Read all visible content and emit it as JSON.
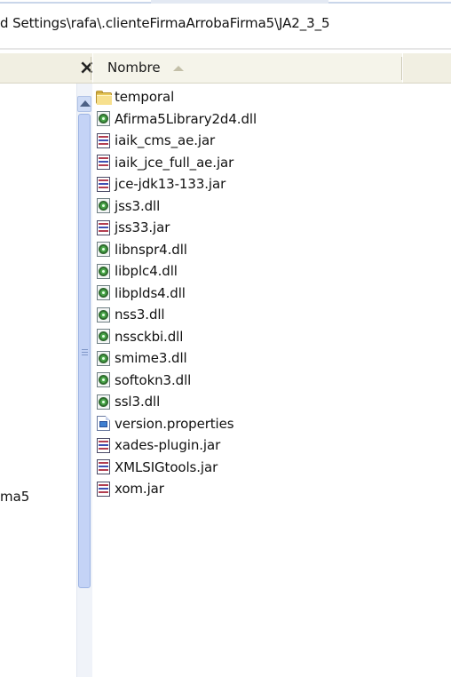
{
  "address_bar": {
    "path_text": "d Settings\\rafa\\.clienteFirmaArrobaFirma5\\JA2_3_5"
  },
  "folder_pane": {
    "close_label": "×",
    "partial_item_label": "ma5"
  },
  "columns": {
    "name_header": "Nombre",
    "sort_icon": "sort-ascending-arrow"
  },
  "files": [
    {
      "name": "temporal",
      "icon": "folder-icon"
    },
    {
      "name": "Afirma5Library2d4.dll",
      "icon": "dll-icon"
    },
    {
      "name": "iaik_cms_ae.jar",
      "icon": "jar-icon"
    },
    {
      "name": "iaik_jce_full_ae.jar",
      "icon": "jar-icon"
    },
    {
      "name": "jce-jdk13-133.jar",
      "icon": "jar-icon"
    },
    {
      "name": "jss3.dll",
      "icon": "dll-icon"
    },
    {
      "name": "jss33.jar",
      "icon": "jar-icon"
    },
    {
      "name": "libnspr4.dll",
      "icon": "dll-icon"
    },
    {
      "name": "libplc4.dll",
      "icon": "dll-icon"
    },
    {
      "name": "libplds4.dll",
      "icon": "dll-icon"
    },
    {
      "name": "nss3.dll",
      "icon": "dll-icon"
    },
    {
      "name": "nssckbi.dll",
      "icon": "dll-icon"
    },
    {
      "name": "smime3.dll",
      "icon": "dll-icon"
    },
    {
      "name": "softokn3.dll",
      "icon": "dll-icon"
    },
    {
      "name": "ssl3.dll",
      "icon": "dll-icon"
    },
    {
      "name": "version.properties",
      "icon": "properties-file-icon"
    },
    {
      "name": "xades-plugin.jar",
      "icon": "jar-icon"
    },
    {
      "name": "XMLSIGtools.jar",
      "icon": "jar-icon"
    },
    {
      "name": "xom.jar",
      "icon": "jar-icon"
    }
  ],
  "colors": {
    "header_bg": "#f1efe2",
    "scroll_thumb": "#c4d3f6",
    "folder_yellow": "#e8c95a"
  }
}
